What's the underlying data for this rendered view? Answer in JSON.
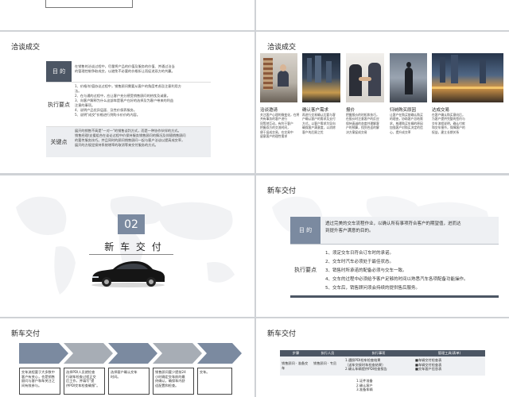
{
  "slides": {
    "s0": {
      "title_button": ""
    },
    "s2": {
      "title": "洽谈成交",
      "rows": [
        {
          "label": "目 的",
          "lines": [
            "在销售的洽谈过程中，尽量将产品的价值及服务的价值、并通过洽当",
            "的管理控制争取成交，以避免不必要的价格折让而促进双方的共赢。"
          ]
        },
        {
          "label": "执行要点",
          "lines": [
            "1、价格/价值协议过程中，销售顾问需要从客户的角度考虑及注意利用方",
            "   法。",
            "2、在与通的过程中，应让客户充分感受销售顾问的热忱及诚意。",
            "3、向客户解释为什么这部车是客户在好的选择及为客户带来的利益",
            "   注意的事项。",
            "4、说明产品优异层面、及性价保养服务。",
            "5、说明\"成交\"价格进行到购卡价价的内容。"
          ]
        },
        {
          "label": "关键点",
          "lines": [
            "展开的销售不高是\"一对一\"的销售谈判方式，而是一种协作伙伴的方式。",
            "销售经理/支援组合在谈论过程中价保持服务销售顾问的情况及伴随销售顾问",
            "的要传服务技巧。并且同时的顾问销售顾问一起与客户洽谈以提高成交率，",
            "展开的方规定接持系统增率的取消等来交付服务的方式。"
          ]
        }
      ]
    },
    "s3": {
      "title": "洽谈成交",
      "columns": [
        {
          "caption": "洽谈邀请",
          "text": [
            "关注客户心理的微变化，在将共有事务的客户进行",
            "同等地互动，有利于客户",
            "把握双方的交流时间，",
            "便于促成交易，在交易中",
            "留意客户的理性需求"
          ]
        },
        {
          "caption": "确认客户需求",
          "text": [
            "再进行交易确认后要与客",
            "户确认客户的需求及支付",
            "方式，以客户需求为导向",
            "确保客户满意度，以消除",
            "客户的后顾之忧"
          ]
        },
        {
          "caption": "报价",
          "text": [
            "把握报价的时机和技巧，",
            "在报价时注意客户的反应",
            "保持真诚的态度并理解客",
            "户的预算，找到合适的解",
            "决方案促成交易"
          ]
        },
        {
          "caption": "归纳购买原因",
          "text": [
            "让客户在购买前确认购买",
            "的理由，协助客户总结需",
            "求，梳理购买车辆的原因",
            "加强客户对购买决定的信",
            "心，提升成交率"
          ]
        },
        {
          "caption": "达成交易",
          "text": [
            "在客户确认购买意向后，",
            "为客户提供完整的签约与",
            "交车流程说明，确认付款",
            "和交车细节，保障客户的",
            "权益，建立长期关系"
          ]
        }
      ]
    },
    "s4": {
      "number": "02",
      "title": "新 车 交 付"
    },
    "s5": {
      "title": "新车交付",
      "rows": [
        {
          "label": "目 的",
          "lines": [
            "透过完美的交车流程作业，以确认所有事项符合客户的期望值，进而达",
            "到提升客户满意的目的。"
          ]
        },
        {
          "label": "执行要点",
          "lines": [
            "1、须定交车日符合订车时的承诺。",
            "2、交车时汽车必须处于最佳状态。",
            "3、销售时所承诺的配备必须与交车一致。",
            "4、交车的过程中必须给予客户足够的时间以熟悉汽车各项配备功能操作。",
            "5、交车后，销售顾问须会持续的提供售后服务。"
          ]
        }
      ]
    },
    "s6": {
      "title": "新车交付",
      "steps": [
        {
          "text": [
            "交车流程要于大多数中",
            "客户有关心，也是销售",
            "顾问与客户和车关注之",
            "间有效参与。"
          ]
        },
        {
          "text": [
            "选择PDI人员就检查",
            "行驶车检查过程正交",
            "后工作，并填写\"提",
            "供PDI交车检查确报\"。"
          ]
        },
        {
          "text": [
            "选择客户确认交车",
            "时间。"
          ]
        },
        {
          "text": [
            "销售顾问要少提前24",
            "小时确定交车前的最",
            "终确认，确保车内舒",
            "适配置和检查。"
          ]
        },
        {
          "text": [
            "交车。"
          ]
        }
      ]
    },
    "s7": {
      "title": "新车交付",
      "headers": [
        "步骤",
        "执行人员",
        "执行事项",
        "管理工具(表单)"
      ],
      "row1": {
        "step": "销售顾问 · 准备交车",
        "person": "销售顾问 · 专员",
        "items": [
          "1.遵照PDI检车检查结果",
          "（送车交接时车检查结果）",
          "2.确认车辆提供PDI检查报告"
        ],
        "tools": [
          "■车辆交付检查表",
          "■车辆交付检查表",
          "■交车客户信息表"
        ]
      },
      "row2": {
        "items": [
          "1.证件准备",
          "2.确认客户",
          "3.准备车辆"
        ]
      }
    }
  }
}
